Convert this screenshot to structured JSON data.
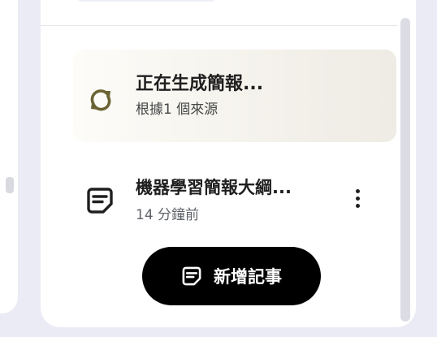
{
  "generating": {
    "title": "正在生成簡報...",
    "subtitle": "根據1 個來源",
    "icon": "sync-icon",
    "accent_color": "#6b6333"
  },
  "note": {
    "title": "機器學習簡報大綱...",
    "time": "14 分鐘前",
    "icon": "note-icon",
    "menu_icon": "more-vert-icon"
  },
  "add_note_button": {
    "label": "新增記事",
    "icon": "note-icon"
  }
}
